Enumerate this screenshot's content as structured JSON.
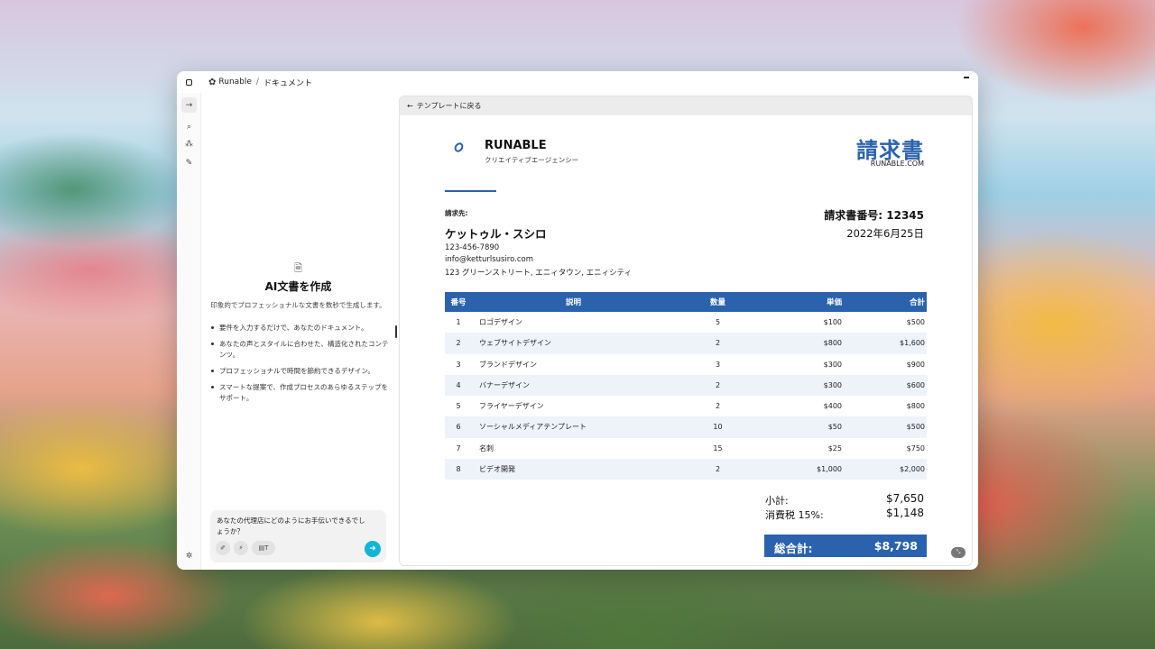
{
  "titlebar": {
    "app_name": "Runable",
    "separator": "/",
    "section": "ドキュメント"
  },
  "left_panel": {
    "title": "AI文書を作成",
    "description": "印象的でプロフェッショナルな文書を数秒で生成します。",
    "bullets": [
      "要件を入力するだけで、あなたのドキュメント。",
      "あなたの声とスタイルに合わせた、構造化されたコンテンツ。",
      "プロフェッショナルで時間を節約できるデザイン。",
      "スマートな提案で、作成プロセスのあらゆるステップをサポート。"
    ],
    "chat_input_value": "あなたの代理店にどのようにお手伝いできるでしょうか？",
    "chat_tool_extra": "T"
  },
  "doc_panel": {
    "back_label": "テンプレートに戻る"
  },
  "invoice": {
    "brand_name": "RUNABLE",
    "brand_sub": "クリエイティブエージェンシー",
    "title": "請求書",
    "site": "RUNABLE.COM",
    "bill_to_label": "請求先:",
    "client_name": "ケットゥル・スシロ",
    "client_phone": "123-456-7890",
    "client_email": "info@ketturlsusiro.com",
    "client_address": "123 グリーンストリート, エニィタウン, エニィシティ",
    "invoice_number": "請求書番号: 12345",
    "date": "2022年6月25日",
    "columns": [
      "番号",
      "説明",
      "数量",
      "単価",
      "合計"
    ],
    "rows": [
      [
        "1",
        "ロゴデザイン",
        "5",
        "$100",
        "$500"
      ],
      [
        "2",
        "ウェブサイトデザイン",
        "2",
        "$800",
        "$1,600"
      ],
      [
        "3",
        "ブランドデザイン",
        "3",
        "$300",
        "$900"
      ],
      [
        "4",
        "バナーデザイン",
        "2",
        "$300",
        "$600"
      ],
      [
        "5",
        "フライヤーデザイン",
        "2",
        "$400",
        "$800"
      ],
      [
        "6",
        "ソーシャルメディアテンプレート",
        "10",
        "$50",
        "$500"
      ],
      [
        "7",
        "名刺",
        "15",
        "$25",
        "$750"
      ],
      [
        "8",
        "ビデオ開発",
        "2",
        "$1,000",
        "$2,000"
      ]
    ],
    "subtotal_label": "小計:",
    "subtotal_value": "$7,650",
    "tax_label": "消費税 15%:",
    "tax_value": "$1,148",
    "grand_label": "総合計:",
    "grand_value": "$8,798"
  },
  "colors": {
    "accent": "#2b62ad",
    "send_button": "#11b5d6"
  }
}
